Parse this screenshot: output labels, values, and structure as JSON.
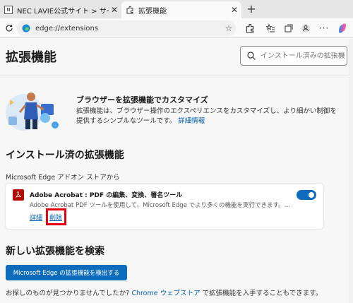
{
  "tabs": [
    {
      "title": "NEC LAVIE公式サイト > サービス&サ",
      "icon": "nec-favicon",
      "active": false
    },
    {
      "title": "拡張機能",
      "icon": "extensions-icon",
      "active": true
    }
  ],
  "address_bar": {
    "url": "edge://extensions"
  },
  "page": {
    "title": "拡張機能",
    "search_placeholder": "インストール済みの拡張機能",
    "promo": {
      "title": "ブラウザーを拡張機能でカスタマイズ",
      "description": "拡張機能は、ブラウザー操作のエクスペリエンスをカスタマイズし、より細かい制御を提供するシンプルなツールです。",
      "link": "詳細情報"
    },
    "installed_title": "インストール済の拡張機能",
    "source_label": "Microsoft Edge アドオン ストアから",
    "extension": {
      "name": "Adobe Acrobat : PDF の編集、変換、署名ツール",
      "description": "Adobe Acrobat PDF ツールを使用して、Microsoft Edge でより多くの機能を実行できます。表示、入力、コメ...",
      "details_label": "詳細",
      "remove_label": "削除",
      "enabled": true
    },
    "find_title": "新しい拡張機能を検索",
    "find_button": "Microsoft Edge の拡張機能を検出する",
    "footer_prefix": "お探しのものが見つかりませんでしたか?",
    "footer_link": "Chrome ウェブストア",
    "footer_suffix": "で拡張機能を入手することもできます。"
  },
  "colors": {
    "accent": "#0f6cbd",
    "highlight": "#e60012",
    "link": "#005fb8"
  }
}
